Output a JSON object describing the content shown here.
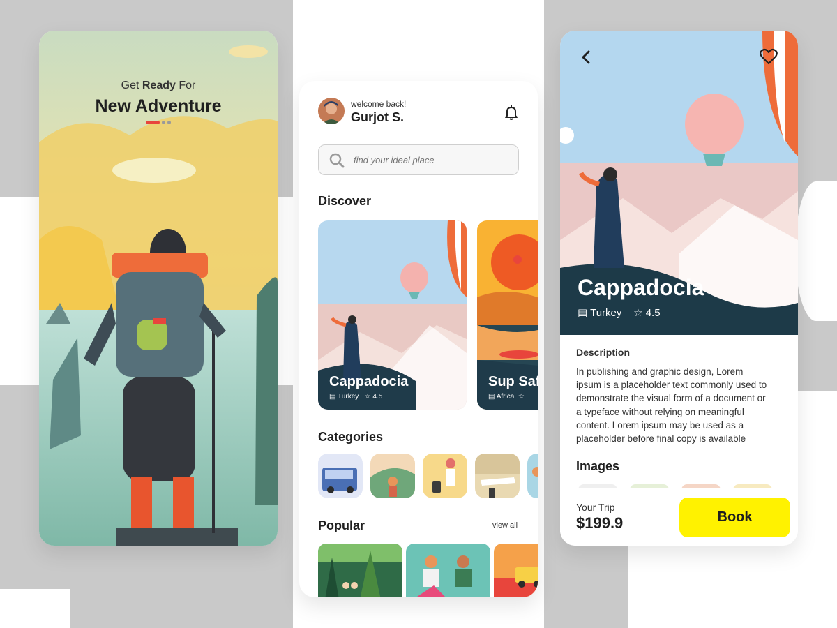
{
  "onboarding": {
    "line1_prefix": "Get",
    "line1_bold": "Ready",
    "line1_suffix": "For",
    "headline": "New Adventure"
  },
  "home": {
    "greeting": "welcome back!",
    "user_name": "Gurjot S.",
    "search": {
      "placeholder": "find your ideal place",
      "icon": "search-icon"
    },
    "discover_title": "Discover",
    "discover_cards": [
      {
        "title": "Cappadocia",
        "location": "Turkey",
        "rating": "4.5"
      },
      {
        "title": "Sup Saf",
        "location": "Africa"
      }
    ],
    "categories_title": "Categories",
    "popular_title": "Popular",
    "view_all_label": "view all"
  },
  "detail": {
    "title": "Cappadocia",
    "location": "Turkey",
    "rating": "4.5",
    "description_title": "Description",
    "description_lines": [
      "In publishing and graphic design, Lorem",
      "ipsum is a placeholder text commonly used to",
      "demonstrate the visual form of a document or",
      "a typeface without relying on meaningful",
      "content. Lorem ipsum may be used as a",
      "placeholder before final copy is available"
    ],
    "images_title": "Images",
    "trip_label": "Your Trip",
    "price": "$199.9",
    "book_label": "Book"
  },
  "colors": {
    "book_button": "#fff200",
    "page_indicator_active": "#e8453c",
    "accent_orange": "#ee6c3a"
  }
}
